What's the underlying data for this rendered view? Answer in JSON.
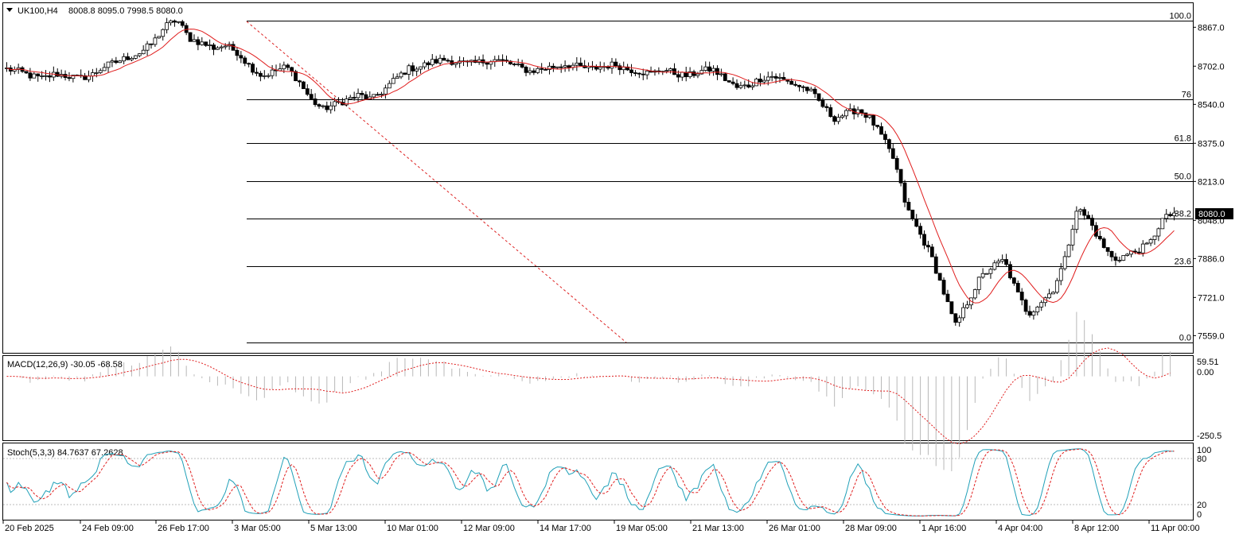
{
  "header": {
    "symbol": "UK100,H4",
    "ohlc": "8008.8 8095.0 7998.5 8080.0",
    "collapse_icon": "triangle-down-icon"
  },
  "price_axis": {
    "ticks": [
      "8867.0",
      "8702.0",
      "8540.0",
      "8375.0",
      "8213.0",
      "8048.0",
      "7886.0",
      "7721.0",
      "7559.0"
    ],
    "current_price": "8080.0"
  },
  "time_axis": {
    "labels": [
      "20 Feb 2025",
      "24 Feb 09:00",
      "26 Feb 17:00",
      "3 Mar 05:00",
      "5 Mar 13:00",
      "10 Mar 01:00",
      "12 Mar 09:00",
      "14 Mar 17:00",
      "19 Mar 05:00",
      "21 Mar 13:00",
      "26 Mar 01:00",
      "28 Mar 09:00",
      "1 Apr 16:00",
      "4 Apr 04:00",
      "8 Apr 12:00",
      "11 Apr 00:00"
    ]
  },
  "fibonacci": {
    "levels": [
      {
        "label": "100.0",
        "price": 8895
      },
      {
        "label": "76",
        "price": 8563
      },
      {
        "label": "61.8",
        "price": 8375
      },
      {
        "label": "50.0",
        "price": 8213
      },
      {
        "label": "38.2",
        "price": 8055
      },
      {
        "label": "23.6",
        "price": 7854
      },
      {
        "label": "0.0",
        "price": 7530
      }
    ]
  },
  "macd": {
    "label": "MACD(12,26,9) -30.05 -68.58",
    "ticks": [
      "59.51",
      "0.00",
      "-250.5"
    ]
  },
  "stoch": {
    "label": "Stoch(5,3,3) 84.7637 67.2628",
    "ticks": [
      "100",
      "80",
      "20",
      "0"
    ]
  },
  "colors": {
    "ma": "#e01e1e",
    "signal": "#e01e1e",
    "stoch_main": "#20a0b8",
    "histogram": "#b8b8b8",
    "candle": "#000000",
    "grid": "#000000"
  },
  "chart_data": {
    "type": "line",
    "description_series": "UK100 H4 price path (approximate closes)",
    "x_labels": [
      "20 Feb 2025",
      "24 Feb 09:00",
      "26 Feb 17:00",
      "3 Mar 05:00",
      "5 Mar 13:00",
      "10 Mar 01:00",
      "12 Mar 09:00",
      "14 Mar 17:00",
      "19 Mar 05:00",
      "21 Mar 13:00",
      "26 Mar 01:00",
      "28 Mar 09:00",
      "1 Apr 16:00",
      "4 Apr 04:00",
      "8 Apr 12:00",
      "11 Apr 00:00"
    ],
    "price_anchors": [
      8690,
      8680,
      8660,
      8650,
      8670,
      8660,
      8650,
      8665,
      8700,
      8720,
      8740,
      8760,
      8800,
      8870,
      8900,
      8820,
      8800,
      8780,
      8790,
      8760,
      8700,
      8660,
      8680,
      8700,
      8640,
      8560,
      8520,
      8540,
      8560,
      8580,
      8560,
      8600,
      8650,
      8690,
      8700,
      8720,
      8730,
      8720,
      8710,
      8720,
      8730,
      8720,
      8700,
      8680,
      8690,
      8700,
      8710,
      8700,
      8690,
      8700,
      8710,
      8690,
      8680,
      8670,
      8690,
      8670,
      8660,
      8680,
      8690,
      8650,
      8610,
      8620,
      8650,
      8660,
      8640,
      8620,
      8600,
      8540,
      8480,
      8500,
      8520,
      8480,
      8400,
      8300,
      8100,
      8000,
      7900,
      7750,
      7600,
      7700,
      7800,
      7850,
      7880,
      7750,
      7650,
      7700,
      7750,
      7880,
      8100,
      8050,
      7950,
      7880,
      7900,
      7920,
      7950,
      8050,
      8080
    ],
    "ylim": [
      7530,
      8895
    ],
    "macd_range": [
      -250.5,
      59.51
    ],
    "stoch_range": [
      0,
      100
    ],
    "fib_levels": {
      "100.0": 8895,
      "76": 8563,
      "61.8": 8375,
      "50.0": 8213,
      "38.2": 8055,
      "23.6": 7854,
      "0.0": 7530
    }
  }
}
